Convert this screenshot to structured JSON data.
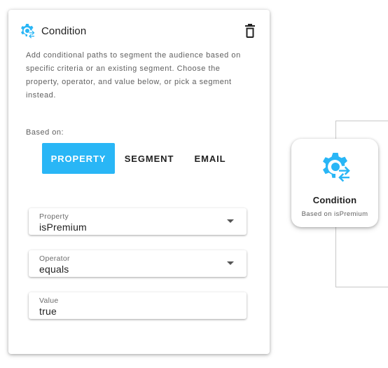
{
  "panel": {
    "title": "Condition",
    "icon": "settings-sync-icon",
    "accent_color": "#29b6f6",
    "description": "Add conditional paths to segment the audience based on specific criteria or an existing segment. Choose the property, operator, and value below, or pick a segment instead.",
    "based_on_label": "Based on:",
    "toggle": {
      "options": [
        "PROPERTY",
        "SEGMENT",
        "EMAIL"
      ],
      "selected": "PROPERTY"
    },
    "fields": {
      "property": {
        "label": "Property",
        "value": "isPremium"
      },
      "operator": {
        "label": "Operator",
        "value": "equals"
      },
      "value": {
        "label": "Value",
        "value": "true"
      }
    }
  },
  "node": {
    "title": "Condition",
    "subtitle": "Based on isPremium",
    "icon": "settings-sync-icon"
  }
}
